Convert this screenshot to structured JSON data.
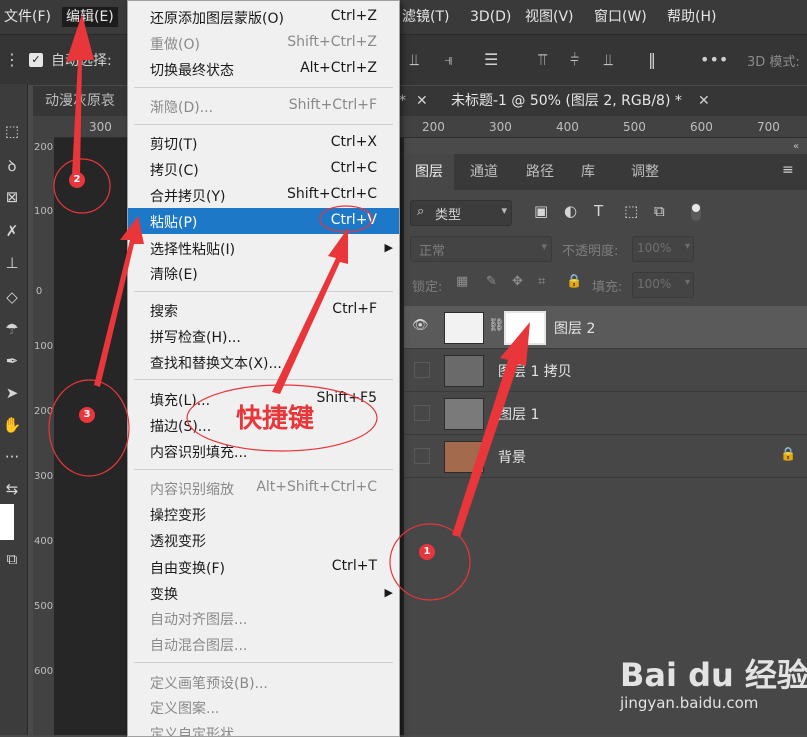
{
  "menubar": {
    "items": [
      {
        "label": "文件(F)"
      },
      {
        "label": "编辑(E)"
      },
      {
        "label": "滤镜(T)"
      },
      {
        "label": "3D(D)"
      },
      {
        "label": "视图(V)"
      },
      {
        "label": "窗口(W)"
      },
      {
        "label": "帮助(H)"
      }
    ]
  },
  "options_bar": {
    "auto_select_label": "自动选择:",
    "mode_3d_label": "3D 模式:"
  },
  "document_tabs": [
    {
      "label": "动漫灰原哀"
    },
    {
      "label": "未标题-1 @ 50% (图层 2, RGB/8) *"
    }
  ],
  "ruler_top": {
    "ticks": [
      "300",
      "200",
      "300",
      "400",
      "500",
      "600",
      "700"
    ]
  },
  "ruler_left": {
    "ticks": [
      "200",
      "100",
      "0",
      "100",
      "200",
      "300",
      "400",
      "500",
      "600"
    ]
  },
  "layers_panel": {
    "tabs": [
      {
        "label": "图层",
        "active": true
      },
      {
        "label": "通道"
      },
      {
        "label": "路径"
      },
      {
        "label": "库"
      },
      {
        "label": "调整"
      }
    ],
    "filter_label": "类型",
    "blend_mode": "正常",
    "opacity_label": "不透明度:",
    "opacity_value": "100%",
    "lock_label": "锁定:",
    "fill_label": "填充:",
    "fill_value": "100%",
    "layers": [
      {
        "name": "图层 2",
        "selected": true,
        "visible": true
      },
      {
        "name": "图层 1 拷贝",
        "selected": false,
        "visible": false
      },
      {
        "name": "图层 1",
        "selected": false,
        "visible": false
      },
      {
        "name": "背景",
        "selected": false,
        "visible": false,
        "locked": true
      }
    ]
  },
  "edit_menu": {
    "groups": [
      [
        {
          "label": "还原添加图层蒙版(O)",
          "shortcut": "Ctrl+Z"
        },
        {
          "label": "重做(O)",
          "shortcut": "Shift+Ctrl+Z",
          "disabled": true
        },
        {
          "label": "切换最终状态",
          "shortcut": "Alt+Ctrl+Z"
        }
      ],
      [
        {
          "label": "渐隐(D)...",
          "shortcut": "Shift+Ctrl+F",
          "disabled": true
        }
      ],
      [
        {
          "label": "剪切(T)",
          "shortcut": "Ctrl+X"
        },
        {
          "label": "拷贝(C)",
          "shortcut": "Ctrl+C"
        },
        {
          "label": "合并拷贝(Y)",
          "shortcut": "Shift+Ctrl+C"
        },
        {
          "label": "粘贴(P)",
          "shortcut": "Ctrl+V",
          "highlight": true
        },
        {
          "label": "选择性粘贴(I)",
          "shortcut": "",
          "submenu": true
        },
        {
          "label": "清除(E)",
          "shortcut": ""
        }
      ],
      [
        {
          "label": "搜索",
          "shortcut": "Ctrl+F"
        },
        {
          "label": "拼写检查(H)...",
          "shortcut": ""
        },
        {
          "label": "查找和替换文本(X)...",
          "shortcut": ""
        }
      ],
      [
        {
          "label": "填充(L)...",
          "shortcut": "Shift+F5"
        },
        {
          "label": "描边(S)...",
          "shortcut": ""
        },
        {
          "label": "内容识别填充...",
          "shortcut": ""
        }
      ],
      [
        {
          "label": "内容识别缩放",
          "shortcut": "Alt+Shift+Ctrl+C",
          "disabled": true
        },
        {
          "label": "操控变形",
          "shortcut": ""
        },
        {
          "label": "透视变形",
          "shortcut": ""
        },
        {
          "label": "自由变换(F)",
          "shortcut": "Ctrl+T"
        },
        {
          "label": "变换",
          "shortcut": "",
          "submenu": true
        },
        {
          "label": "自动对齐图层...",
          "shortcut": "",
          "disabled": true
        },
        {
          "label": "自动混合图层...",
          "shortcut": "",
          "disabled": true
        }
      ],
      [
        {
          "label": "定义画笔预设(B)...",
          "shortcut": "",
          "disabled": true
        },
        {
          "label": "定义图案...",
          "shortcut": "",
          "disabled": true
        },
        {
          "label": "定义自定形状...",
          "shortcut": "",
          "disabled": true
        }
      ]
    ]
  },
  "annotations": {
    "badges": [
      "1",
      "2",
      "3"
    ],
    "shortcut_note": "快捷键",
    "color": "#e8363b"
  },
  "watermark": {
    "logo": "Bai du 经验",
    "url": "jingyan.baidu.com"
  },
  "colors": {
    "menu_highlight": "#1e78c8",
    "menu_bg": "#f0f0f0",
    "panel_bg": "#474747"
  }
}
